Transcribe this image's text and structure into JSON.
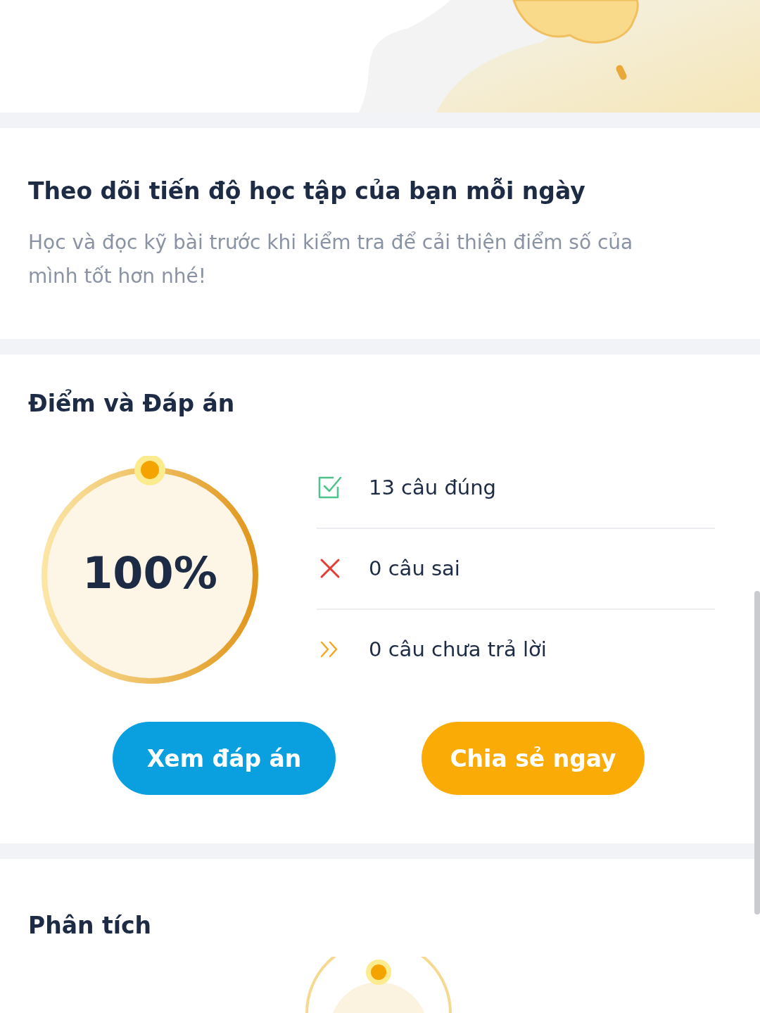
{
  "progress_intro": {
    "title": "Theo dõi tiến độ học tập của bạn mỗi ngày",
    "description": "Học và đọc kỹ bài trước khi kiểm tra để cải thiện điểm số của mình tốt hơn nhé!"
  },
  "score": {
    "title": "Điểm và Đáp án",
    "percent": "100%",
    "ring": {
      "level": 1
    },
    "stats": [
      {
        "kind": "correct",
        "text": "13 câu đúng"
      },
      {
        "kind": "wrong",
        "text": "0 câu sai"
      },
      {
        "kind": "skipped",
        "text": "0 câu chưa trả lời"
      }
    ],
    "buttons": [
      {
        "kind": "primary",
        "label": "Xem đáp án"
      },
      {
        "kind": "share",
        "label": "Chia sẻ ngay"
      }
    ]
  },
  "analysis": {
    "title": "Phân tích"
  }
}
